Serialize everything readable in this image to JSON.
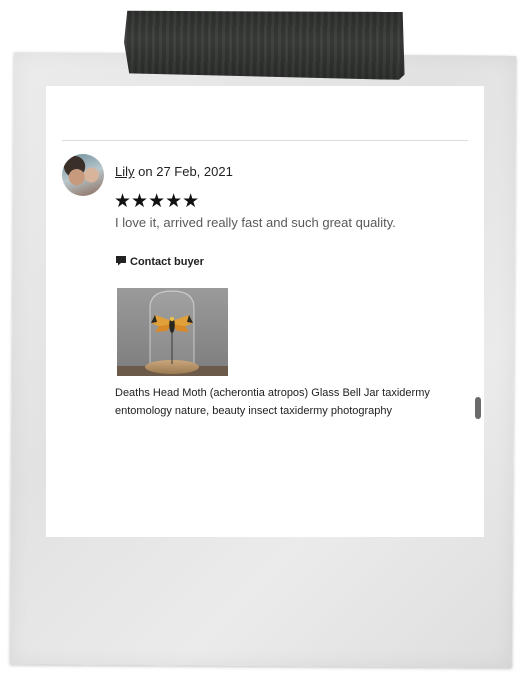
{
  "review": {
    "reviewer_name": "Lily",
    "date_text": "on 27 Feb, 2021",
    "rating": 5,
    "stars_text": "★★★★★",
    "text": "I love it, arrived really fast and such great quality.",
    "contact_label": "Contact buyer"
  },
  "product": {
    "title": "Deaths Head Moth (acherontia atropos) Glass Bell Jar taxidermy entomology nature, beauty insect taxidermy photography"
  },
  "icons": {
    "contact": "message-icon",
    "avatar": "avatar-photo"
  },
  "colors": {
    "text": "#222222",
    "muted_text": "#595959",
    "stars": "#111111",
    "frame": "#e6e6e6",
    "tape": "#333533"
  }
}
